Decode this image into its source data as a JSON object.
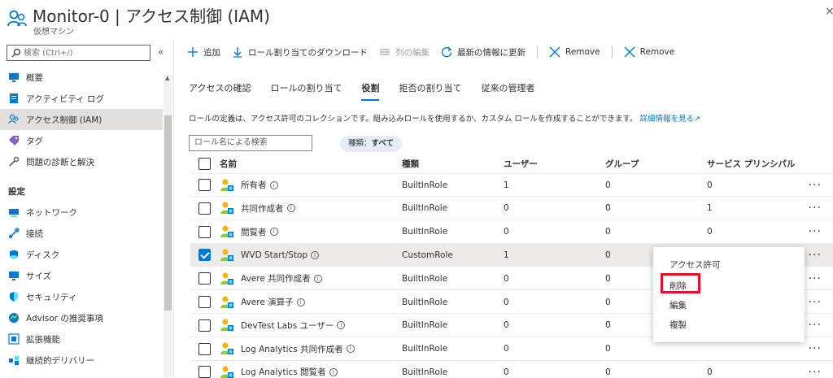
{
  "header": {
    "title": "Monitor-0 | アクセス制御 (IAM)",
    "subtitle": "仮想マシン",
    "close_label": "×"
  },
  "sidebar": {
    "search_placeholder": "検索 (Ctrl+/)",
    "collapse_label": "«",
    "items_top": [
      {
        "label": "概要",
        "icon": "monitor-icon"
      },
      {
        "label": "アクティビティ ログ",
        "icon": "log-icon"
      },
      {
        "label": "アクセス制御 (IAM)",
        "icon": "people-icon",
        "active": true
      },
      {
        "label": "タグ",
        "icon": "tag-icon"
      },
      {
        "label": "問題の診断と解決",
        "icon": "wrench-icon"
      }
    ],
    "section_label": "設定",
    "items_settings": [
      {
        "label": "ネットワーク",
        "icon": "network-icon"
      },
      {
        "label": "接続",
        "icon": "connect-icon"
      },
      {
        "label": "ディスク",
        "icon": "disk-icon"
      },
      {
        "label": "サイズ",
        "icon": "size-icon"
      },
      {
        "label": "セキュリティ",
        "icon": "shield-icon"
      },
      {
        "label": "Advisor の推奨事項",
        "icon": "advisor-icon"
      },
      {
        "label": "拡張機能",
        "icon": "extension-icon"
      },
      {
        "label": "継続的デリバリー",
        "icon": "delivery-icon"
      }
    ]
  },
  "toolbar": {
    "add": "追加",
    "download": "ロール割り当てのダウンロード",
    "edit_columns": "列の編集",
    "refresh": "最新の情報に更新",
    "remove1": "Remove",
    "remove2": "Remove"
  },
  "tabs": [
    {
      "label": "アクセスの確認"
    },
    {
      "label": "ロールの割り当て"
    },
    {
      "label": "役割",
      "active": true
    },
    {
      "label": "拒否の割り当て"
    },
    {
      "label": "従来の管理者"
    }
  ],
  "description": {
    "text": "ロールの定義は、アクセス許可のコレクションです。組み込みロールを使用するか、カスタム ロールを作成することができます。",
    "link": "詳細情報を見る",
    "link_icon": "↗"
  },
  "filters": {
    "role_search_placeholder": "ロール名による検索",
    "type_filter_prefix": "種類：",
    "type_filter_value": "すべて"
  },
  "table": {
    "columns": [
      "名前",
      "種類",
      "ユーザー",
      "グループ",
      "サービス プリンシパル"
    ],
    "rows": [
      {
        "name": "所有者",
        "type": "BuiltInRole",
        "users": "1",
        "groups": "0",
        "sp": "0",
        "selected": false
      },
      {
        "name": "共同作成者",
        "type": "BuiltInRole",
        "users": "0",
        "groups": "0",
        "sp": "1",
        "selected": false
      },
      {
        "name": "閲覧者",
        "type": "BuiltInRole",
        "users": "0",
        "groups": "0",
        "sp": "0",
        "selected": false
      },
      {
        "name": "WVD Start/Stop",
        "type": "CustomRole",
        "users": "1",
        "groups": "0",
        "sp": "",
        "selected": true
      },
      {
        "name": "Avere 共同作成者",
        "type": "BuiltInRole",
        "users": "0",
        "groups": "0",
        "sp": "",
        "selected": false
      },
      {
        "name": "Avere 演算子",
        "type": "BuiltInRole",
        "users": "0",
        "groups": "0",
        "sp": "",
        "selected": false
      },
      {
        "name": "DevTest Labs ユーザー",
        "type": "BuiltInRole",
        "users": "0",
        "groups": "0",
        "sp": "",
        "selected": false
      },
      {
        "name": "Log Analytics 共同作成者",
        "type": "BuiltInRole",
        "users": "0",
        "groups": "0",
        "sp": "",
        "selected": false
      },
      {
        "name": "Log Analytics 閲覧者",
        "type": "BuiltInRole",
        "users": "0",
        "groups": "0",
        "sp": "0",
        "selected": false
      }
    ],
    "more_label": "···",
    "info_glyph": "i"
  },
  "context_menu": {
    "items": [
      "アクセス許可",
      "削除",
      "編集",
      "複製"
    ]
  },
  "colors": {
    "accent": "#0078d4",
    "highlight": "#e81123",
    "selected_row": "#edebe9"
  }
}
